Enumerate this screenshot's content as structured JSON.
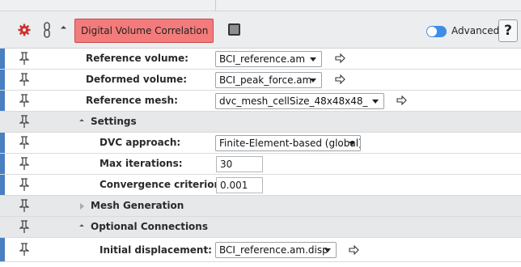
{
  "module": {
    "name": "Digital Volume Correlation",
    "advanced_label": "Advanced",
    "help_label": "?",
    "accent_color": "#f47b7b"
  },
  "ports": {
    "reference_volume": {
      "label": "Reference volume:",
      "value": "BCI_reference.am"
    },
    "deformed_volume": {
      "label": "Deformed volume:",
      "value": "BCI_peak_force.am"
    },
    "reference_mesh": {
      "label": "Reference mesh:",
      "value": "dvc_mesh_cellSize_48x48x48_"
    },
    "settings": {
      "label": "Settings"
    },
    "dvc_approach": {
      "label": "DVC approach:",
      "value": "Finite-Element-based (global)"
    },
    "max_iterations": {
      "label": "Max iterations:",
      "value": "30"
    },
    "convergence": {
      "label": "Convergence criterion:",
      "value": "0.001"
    },
    "mesh_generation": {
      "label": "Mesh Generation"
    },
    "optional_connections": {
      "label": "Optional Connections"
    },
    "initial_displacement": {
      "label": "Initial displacement:",
      "value": "BCI_reference.am.disp"
    }
  },
  "icons": [
    "gear-icon",
    "chain-link-icon",
    "pin-icon",
    "connect-arrow-icon",
    "help-icon"
  ]
}
